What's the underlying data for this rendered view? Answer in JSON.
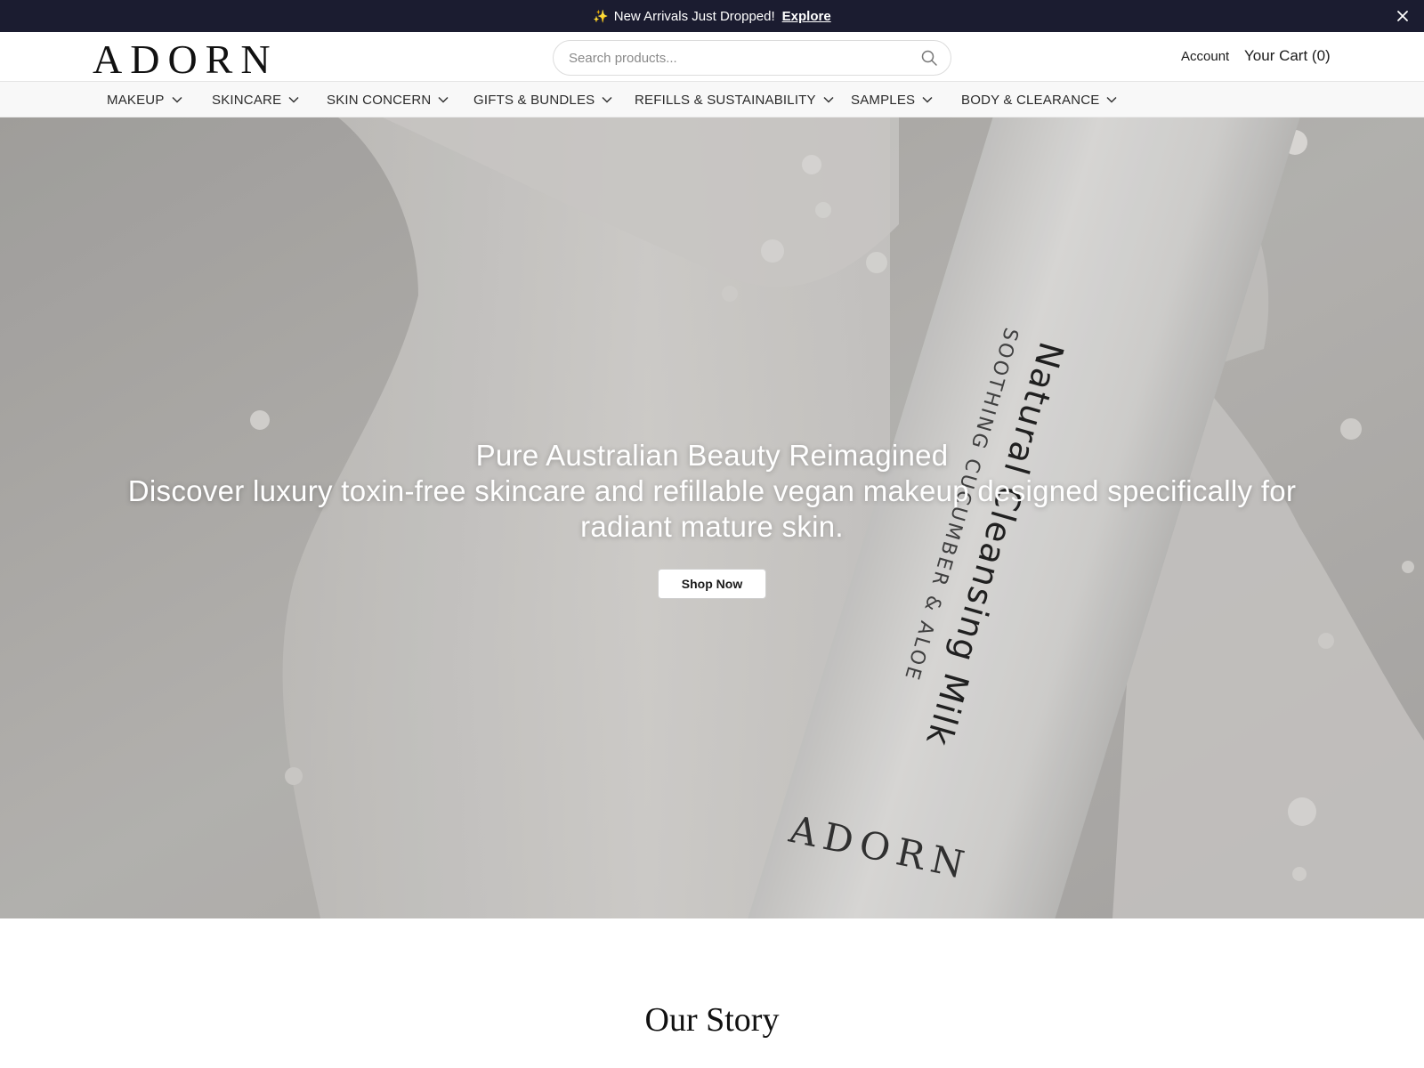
{
  "announcement": {
    "message": "New Arrivals Just Dropped!",
    "link_label": "Explore",
    "sparkle_icon": "✨",
    "background": "#1b1c30"
  },
  "header": {
    "logo": "ADORN",
    "search_placeholder": "Search products...",
    "account_label": "Account",
    "cart_label": "Your Cart (0)"
  },
  "nav": {
    "items": [
      {
        "label": "MAKEUP"
      },
      {
        "label": "SKINCARE"
      },
      {
        "label": "SKIN CONCERN"
      },
      {
        "label": "GIFTS & BUNDLES"
      },
      {
        "label": "REFILLS & SUSTAINABILITY"
      },
      {
        "label": "SAMPLES"
      },
      {
        "label": "BODY & CLEARANCE"
      }
    ]
  },
  "hero": {
    "title": "Pure Australian Beauty Reimagined",
    "subtitle": "Discover luxury toxin-free skincare and refillable vegan makeup designed specifically for radiant mature skin.",
    "cta_label": "Shop Now",
    "product": {
      "name": "Natural Cleansing Milk",
      "variant": "SOOTHING CUCUMBER & ALOE",
      "brand": "ADORN"
    }
  },
  "story": {
    "heading": "Our Story"
  }
}
